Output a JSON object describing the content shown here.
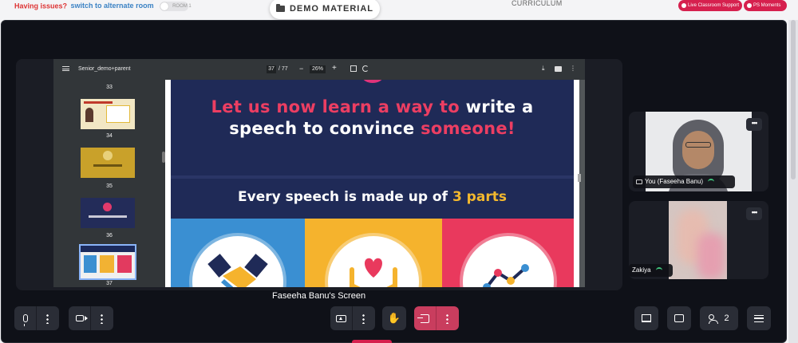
{
  "topbar": {
    "issues_text": "Having issues?",
    "alternate_link": "switch to alternate room",
    "room_toggle": "ROOM 1",
    "demo_material": "DEMO MATERIAL",
    "curriculum": "CURRICULUM",
    "live_support": "Live Classroom Support",
    "ps_moments": "PS Moments"
  },
  "pdf": {
    "title": "Senior_demo+parent",
    "current_page": "37",
    "total_pages": "/ 77",
    "zoom": "26%",
    "thumb_labels": [
      "33",
      "34",
      "35",
      "36",
      "37"
    ]
  },
  "slide": {
    "heading_part1": "Let us now learn a way to",
    "heading_part2": "write a",
    "heading_part3": "speech to convince",
    "heading_part4": "someone!",
    "subheading_part1": "Every speech is made up of",
    "subheading_part2": "3 parts"
  },
  "participants": [
    {
      "name": "You (Faseeha Banu)"
    },
    {
      "name": "Zakiya"
    }
  ],
  "screen_caption": "Faseeha Banu's Screen",
  "controls": {
    "participants_count": "2"
  },
  "colors": {
    "accent": "#d6204e",
    "slide_navy": "#1f2a57",
    "slide_pink": "#ec3e62",
    "slide_yellow": "#f3b82e"
  }
}
